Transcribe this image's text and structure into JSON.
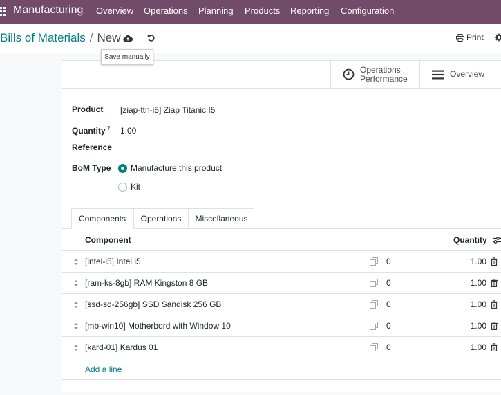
{
  "app": {
    "name": "Manufacturing"
  },
  "nav": [
    "Overview",
    "Operations",
    "Planning",
    "Products",
    "Reporting",
    "Configuration"
  ],
  "breadcrumb": {
    "parent": "Bills of Materials",
    "separator": "/",
    "current": "New"
  },
  "tooltip": "Save manually",
  "actions": {
    "print": "Print"
  },
  "smart_buttons": [
    {
      "line1": "Operations",
      "line2": "Performance",
      "icon": "clock-icon"
    },
    {
      "line1": "Overview",
      "line2": "",
      "icon": "bars-icon"
    }
  ],
  "form": {
    "product_label": "Product",
    "product_value": "[ziap-ttn-i5] Ziap Titanic I5",
    "quantity_label": "Quantity",
    "quantity_help": "?",
    "quantity_value": "1.00",
    "reference_label": "Reference",
    "bom_type_label": "BoM Type",
    "bom_type_options": [
      "Manufacture this product",
      "Kit"
    ],
    "bom_type_selected": 0
  },
  "tabs": [
    "Components",
    "Operations",
    "Miscellaneous"
  ],
  "table": {
    "col_component": "Component",
    "col_quantity": "Quantity",
    "rows": [
      {
        "component": "[intel-i5] Intel i5",
        "zero": "0",
        "qty": "1.00"
      },
      {
        "component": "[ram-ks-8gb] RAM Kingston 8 GB",
        "zero": "0",
        "qty": "1.00"
      },
      {
        "component": "[ssd-sd-256gb] SSD Sandisk 256 GB",
        "zero": "0",
        "qty": "1.00"
      },
      {
        "component": "[mb-win10] Motherbord with Window 10",
        "zero": "0",
        "qty": "1.00"
      },
      {
        "component": "[kard-01] Kardus 01",
        "zero": "0",
        "qty": "1.00"
      }
    ],
    "add_line": "Add a line"
  },
  "colors": {
    "brand": "#714B67",
    "accent": "#017e84"
  }
}
